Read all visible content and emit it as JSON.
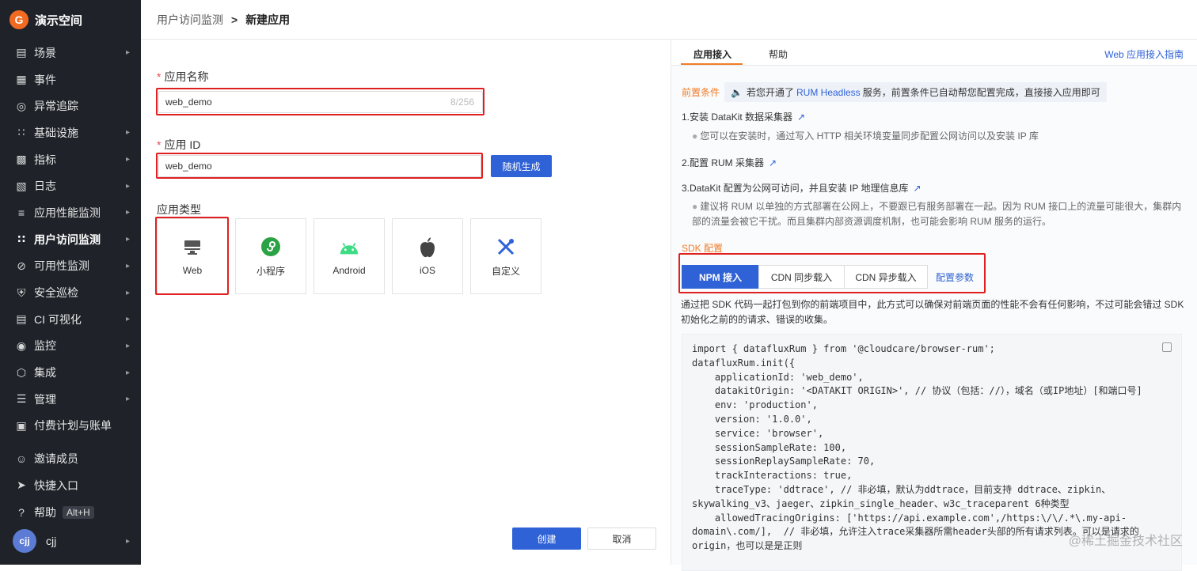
{
  "sidebar": {
    "workspace": "演示空间",
    "items": [
      {
        "label": "场景",
        "icon": "monitor-icon",
        "arrow": true
      },
      {
        "label": "事件",
        "icon": "calendar-icon",
        "arrow": false
      },
      {
        "label": "异常追踪",
        "icon": "target-icon",
        "arrow": false
      },
      {
        "label": "基础设施",
        "icon": "nodes-icon",
        "arrow": true
      },
      {
        "label": "指标",
        "icon": "bar-chart-icon",
        "arrow": true
      },
      {
        "label": "日志",
        "icon": "log-icon",
        "arrow": true
      },
      {
        "label": "应用性能监测",
        "icon": "apm-icon",
        "arrow": true
      },
      {
        "label": "用户访问监测",
        "icon": "grid-icon",
        "arrow": true,
        "active": true
      },
      {
        "label": "可用性监测",
        "icon": "ban-icon",
        "arrow": true
      },
      {
        "label": "安全巡检",
        "icon": "shield-icon",
        "arrow": true
      },
      {
        "label": "CI 可视化",
        "icon": "ci-icon",
        "arrow": true
      },
      {
        "label": "监控",
        "icon": "alarm-icon",
        "arrow": true
      },
      {
        "label": "集成",
        "icon": "hexagon-icon",
        "arrow": true
      },
      {
        "label": "管理",
        "icon": "sliders-icon",
        "arrow": true
      },
      {
        "label": "付费计划与账单",
        "icon": "billing-icon",
        "arrow": false
      }
    ],
    "bottom": {
      "invite": "邀请成员",
      "shortcut": "快捷入口",
      "help": "帮助",
      "help_key": "Alt+H",
      "user": "cjj",
      "avatar_text": "cjj"
    }
  },
  "header": {
    "parent": "用户访问监测",
    "separator": ">",
    "current": "新建应用"
  },
  "form": {
    "name_label": "应用名称",
    "name_value": "web_demo",
    "name_count": "8/256",
    "id_label": "应用 ID",
    "id_value": "web_demo",
    "random_button": "随机生成",
    "type_label": "应用类型",
    "types": [
      "Web",
      "小程序",
      "Android",
      "iOS",
      "自定义"
    ],
    "create_button": "创建",
    "cancel_button": "取消"
  },
  "panel": {
    "tabs": [
      "应用接入",
      "帮助"
    ],
    "guide_link": "Web 应用接入指南",
    "prereq_label": "前置条件",
    "prereq_text_1": "若您开通了",
    "prereq_link": "RUM Headless",
    "prereq_text_2": "服务，前置条件已自动帮您配置完成，直接接入应用即可",
    "step1": "1.安装 DataKit 数据采集器",
    "step1_note": "您可以在安装时，通过写入 HTTP 相关环境变量同步配置公网访问以及安装 IP 库",
    "step2": "2.配置 RUM 采集器",
    "step3": "3.DataKit 配置为公网可访问，并且安装 IP 地理信息库",
    "step3_note_1": "建议将 RUM 以单独的方式部署在公网上，不要跟已有服务部署在一起。因为 RUM 接口上的流量可能很大，集群内",
    "step3_note_2": "部的流量会被它干扰。而且集群内部资源调度机制，也可能会影响 RUM 服务的运行。",
    "sdk_title": "SDK 配置",
    "sdk_tabs": [
      "NPM 接入",
      "CDN 同步载入",
      "CDN 异步载入"
    ],
    "sdk_config_link": "配置参数",
    "desc_1": "通过把 SDK 代码一起打包到你的前端项目中，此方式可以确保对前端页面的性能不会有任何影响，不过可能会错过 SDK",
    "desc_2": "初始化之前的的请求、错误的收集。",
    "code_lines": [
      "import { datafluxRum } from '@cloudcare/browser-rum';",
      "datafluxRum.init({",
      "    applicationId: 'web_demo',",
      "    datakitOrigin: '<DATAKIT ORIGIN>', // 协议（包括：//），域名（或IP地址）[和端口号]",
      "    env: 'production',",
      "    version: '1.0.0',",
      "    service: 'browser',",
      "    sessionSampleRate: 100,",
      "    sessionReplaySampleRate: 70,",
      "    trackInteractions: true,",
      "    traceType: 'ddtrace', // 非必填，默认为ddtrace，目前支持 ddtrace、zipkin、",
      "skywalking_v3、jaeger、zipkin_single_header、w3c_traceparent 6种类型",
      "    allowedTracingOrigins: ['https://api.example.com',/https:\\/\\/.*\\.my-api-",
      "domain\\.com/],  // 非必填，允许注入trace采集器所需header头部的所有请求列表。可以是请求的",
      "origin，也可以是是正则"
    ]
  },
  "watermark": "@稀土掘金技术社区",
  "colors": {
    "primary": "#2f62d6",
    "accent": "#f07c28",
    "highlight": "#e02020",
    "sidebar": "#1f2329"
  }
}
